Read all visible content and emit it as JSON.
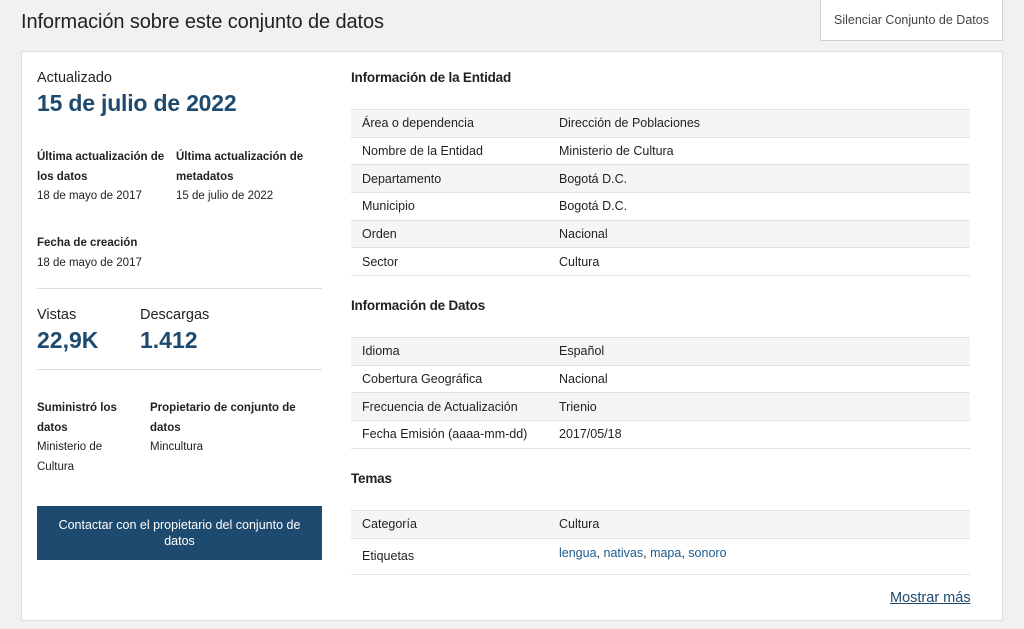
{
  "header": {
    "title": "Información sobre este conjunto de datos",
    "mute_button": "Silenciar Conjunto de Datos"
  },
  "left": {
    "updated_label": "Actualizado",
    "updated_date": "15 de julio de 2022",
    "data_update_label": "Última actualización de los datos",
    "data_update_value": "18 de mayo de 2017",
    "metadata_update_label": "Última actualización de metadatos",
    "metadata_update_value": "15 de julio de 2022",
    "created_label": "Fecha de creación",
    "created_value": "18 de mayo de 2017",
    "views_label": "Vistas",
    "views_value": "22,9K",
    "downloads_label": "Descargas",
    "downloads_value": "1.412",
    "supplier_label": "Suministró los datos",
    "supplier_value": "Ministerio de Cultura",
    "owner_label": "Propietario de conjunto de datos",
    "owner_value": "Mincultura",
    "contact_button": "Contactar con el propietario del conjunto de datos"
  },
  "entity": {
    "title": "Información de la Entidad",
    "rows": [
      {
        "k": "Área o dependencia",
        "v": "Dirección de Poblaciones"
      },
      {
        "k": "Nombre de la Entidad",
        "v": "Ministerio de Cultura"
      },
      {
        "k": "Departamento",
        "v": "Bogotá D.C."
      },
      {
        "k": "Municipio",
        "v": "Bogotá D.C."
      },
      {
        "k": "Orden",
        "v": "Nacional"
      },
      {
        "k": "Sector",
        "v": "Cultura"
      }
    ]
  },
  "data_info": {
    "title": "Información de Datos",
    "rows": [
      {
        "k": "Idioma",
        "v": "Español"
      },
      {
        "k": "Cobertura Geográfica",
        "v": "Nacional"
      },
      {
        "k": "Frecuencia de Actualización",
        "v": "Trienio"
      },
      {
        "k": "Fecha Emisión (aaaa-mm-dd)",
        "v": "2017/05/18"
      }
    ]
  },
  "topics": {
    "title": "Temas",
    "category_label": "Categoría",
    "category_value": "Cultura",
    "tags_label": "Etiquetas",
    "tags": [
      "lengua",
      "nativas",
      "mapa",
      "sonoro"
    ]
  },
  "show_more": "Mostrar más",
  "colors": {
    "accent": "#1d4a6e",
    "link": "#1d5a8a"
  }
}
